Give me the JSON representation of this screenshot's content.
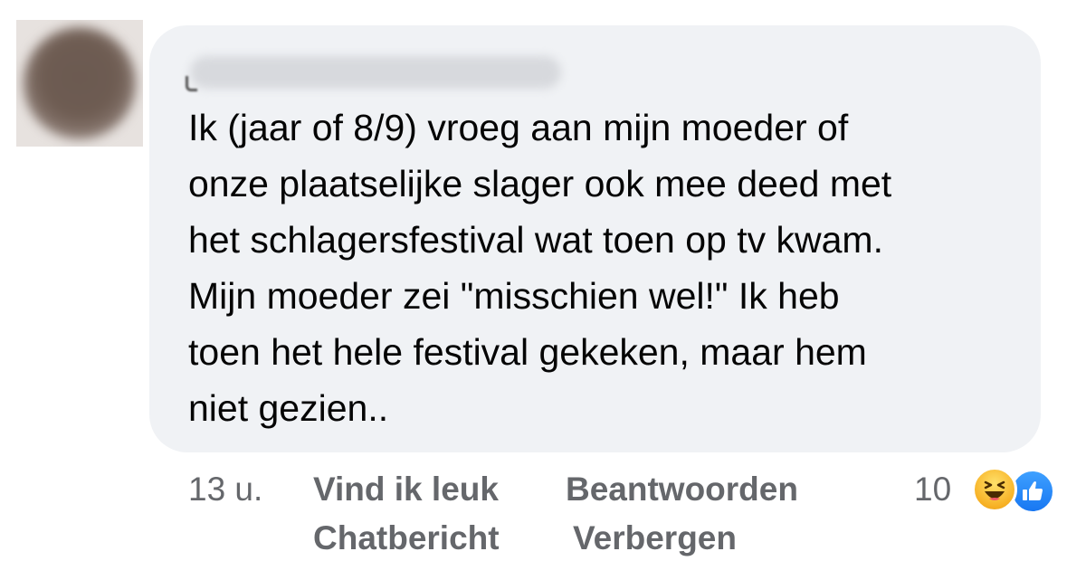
{
  "comment": {
    "author_name": "",
    "lines": [
      "Ik (jaar of 8/9) vroeg aan mijn moeder of",
      "onze plaatselijke slager ook mee deed met",
      "het schlagersfestival wat toen op tv kwam.",
      "Mijn moeder zei \"misschien wel!\" Ik heb",
      "toen het hele festival gekeken, maar hem",
      "niet gezien.."
    ]
  },
  "actions": {
    "timestamp": "13 u.",
    "like_label": "Vind ik leuk",
    "reply_label": "Beantwoorden",
    "chat_label": "Chatbericht",
    "hide_label": "Verbergen"
  },
  "reactions": {
    "count": "10",
    "icons": [
      "haha-icon",
      "like-icon"
    ]
  },
  "colors": {
    "bubble": "#f0f2f5",
    "text": "#050505",
    "secondary_text": "#65676b",
    "like_blue": "#1877f2",
    "haha_yellow": "#f7b125"
  }
}
